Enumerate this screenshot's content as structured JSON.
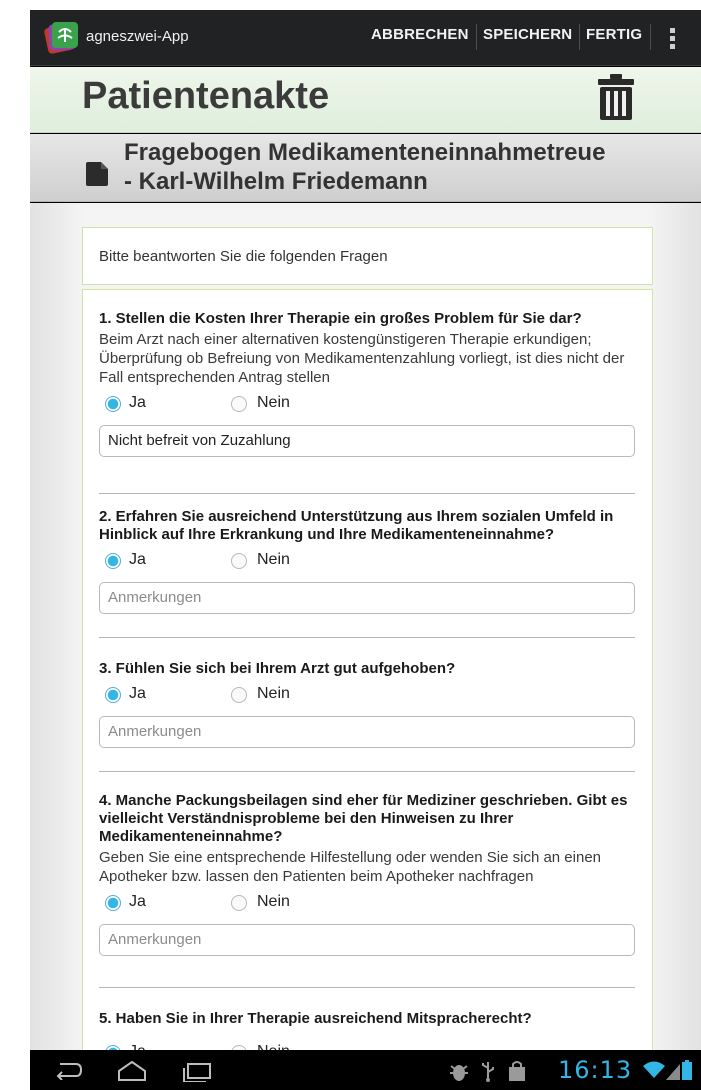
{
  "actionbar": {
    "app_title": "agneszwei-App",
    "cancel_label": "ABBRECHEN",
    "save_label": "SPEICHERN",
    "done_label": "FERTIG"
  },
  "header": {
    "title": "Patientenakte"
  },
  "section": {
    "title_line1": "Fragebogen Medikamenteneinnahmetreue",
    "title_line2": "- Karl-Wilhelm Friedemann"
  },
  "form": {
    "intro": "Bitte beantworten Sie die folgenden Fragen",
    "option_yes": "Ja",
    "option_no": "Nein",
    "questions": [
      {
        "title": "1. Stellen die Kosten Ihrer Therapie ein großes Problem für Sie dar?",
        "hint": "Beim Arzt nach einer alternativen kostengünstigeren Therapie erkundigen; Überprüfung ob Befreiung von Medikamentenzahlung vorliegt, ist dies nicht der Fall entsprechenden Antrag stellen",
        "selected": "Ja",
        "field_value": "Nicht befreit von Zuzahlung"
      },
      {
        "title": "2. Erfahren Sie ausreichend Unterstützung aus Ihrem sozialen Umfeld in Hinblick auf Ihre Erkrankung und Ihre Medikamenteneinnahme?",
        "selected": "Ja",
        "field_placeholder": "Anmerkungen"
      },
      {
        "title": "3. Fühlen Sie sich bei Ihrem Arzt gut aufgehoben?",
        "selected": "Ja",
        "field_placeholder": "Anmerkungen"
      },
      {
        "title": "4. Manche Packungsbeilagen sind eher für Mediziner geschrieben. Gibt es vielleicht Verständnisprobleme bei den Hinweisen zu Ihrer Medikamenteneinnahme?",
        "hint": "Geben Sie eine entsprechende Hilfestellung oder wenden Sie sich an einen Apotheker bzw. lassen den Patienten beim Apotheker nachfragen",
        "selected": "Ja",
        "field_placeholder": "Anmerkungen"
      },
      {
        "title": "5. Haben Sie in Ihrer Therapie ausreichend Mitspracherecht?",
        "selected": "Ja"
      }
    ]
  },
  "statusbar": {
    "time": "16:13"
  },
  "colors": {
    "accent": "#33b5e5",
    "header_green": "#dfeedd",
    "border_green": "#cfe3a3"
  },
  "icons": [
    "app-logo-icon",
    "overflow-menu-icon",
    "trash-icon",
    "document-icon",
    "back-icon",
    "home-icon",
    "recent-apps-icon",
    "debug-icon",
    "usb-icon",
    "shopping-bag-icon",
    "wifi-icon",
    "signal-icon",
    "battery-icon"
  ]
}
